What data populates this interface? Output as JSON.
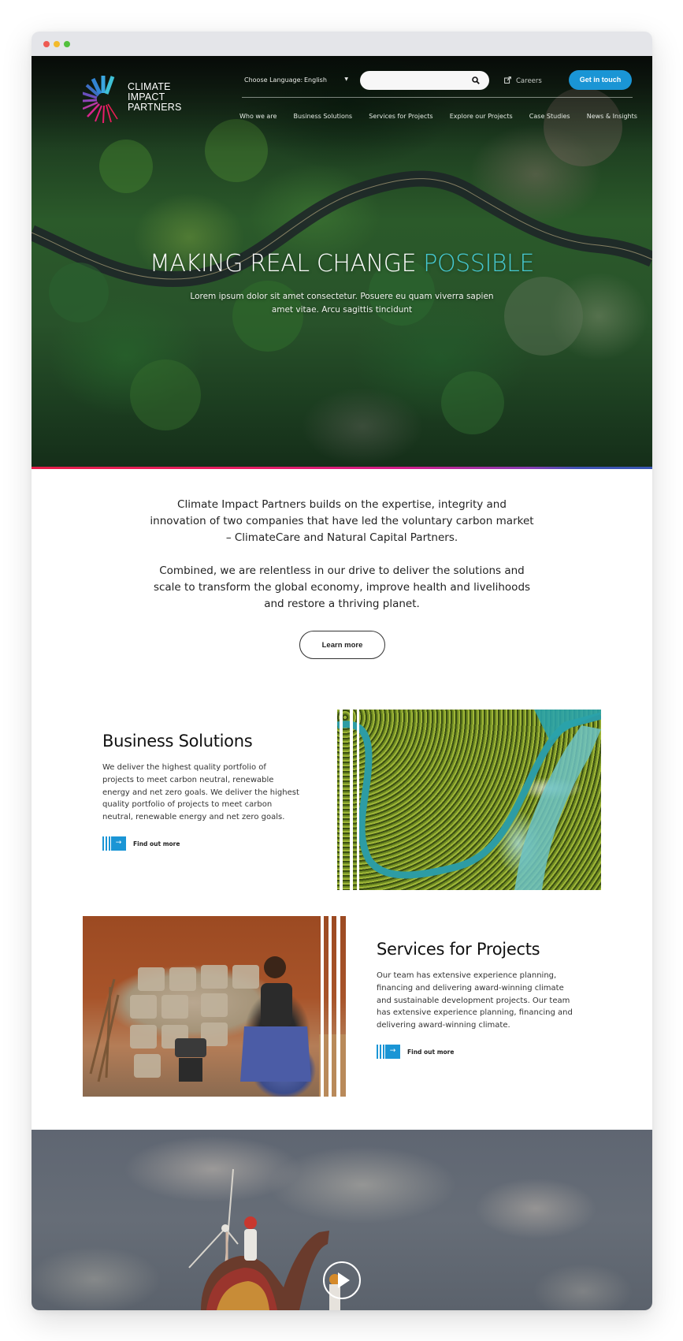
{
  "browser": {
    "window_controls": [
      "close",
      "minimize",
      "maximize"
    ]
  },
  "header": {
    "logo_lines": [
      "CLIMATE",
      "IMPACT",
      "PARTNERS"
    ],
    "language_label": "Choose Language:",
    "language_selected": "English",
    "search_placeholder": "",
    "search_icon": "search-icon",
    "careers_label": "Careers",
    "careers_icon": "external-link-icon",
    "cta_label": "Get in touch",
    "nav": [
      {
        "label": "Who we are"
      },
      {
        "label": "Business Solutions"
      },
      {
        "label": "Services for Projects"
      },
      {
        "label": "Explore our Projects"
      },
      {
        "label": "Case Studies"
      },
      {
        "label": "News & Insights"
      }
    ]
  },
  "hero": {
    "title_main": "MAKING REAL CHANGE ",
    "title_accent": "POSSIBLE",
    "subtitle": "Lorem ipsum dolor sit amet consectetur. Posuere eu quam viverra sapien amet vitae. Arcu sagittis tincidunt"
  },
  "intro": {
    "paragraphs": [
      "Climate Impact Partners builds on the expertise, integrity and innovation of two companies that have led the voluntary carbon market – ClimateCare and Natural Capital Partners.",
      "Combined, we are relentless in our drive to deliver the solutions and scale to transform the global economy, improve health and livelihoods and restore a thriving planet."
    ],
    "button_label": "Learn more"
  },
  "features": [
    {
      "title": "Business Solutions",
      "body": "We deliver the highest quality portfolio of projects to meet carbon neutral, renewable energy and net zero goals. We deliver the highest quality portfolio of projects to meet carbon neutral, renewable energy and net zero goals.",
      "link_label": "Find out more",
      "link_icon": "arrow-right-icon",
      "image": "aerial river through forest"
    },
    {
      "title": "Services for Projects",
      "body": "Our team has extensive experience planning, financing and delivering award-winning climate and sustainable development projects. Our team has extensive experience planning, financing and delivering award-winning climate.",
      "link_label": "Find out more",
      "link_icon": "arrow-right-icon",
      "image": "woman seated beside clay cookstoves"
    }
  ],
  "video": {
    "image": "camel rider beside wind turbine",
    "play_icon": "play-icon"
  },
  "colors": {
    "accent_blue": "#1a95d5",
    "hero_accent": "#46c9d2",
    "gradient_bar": [
      "#e61e4a",
      "#d31d8c",
      "#8b3bb5",
      "#3957b4"
    ]
  }
}
